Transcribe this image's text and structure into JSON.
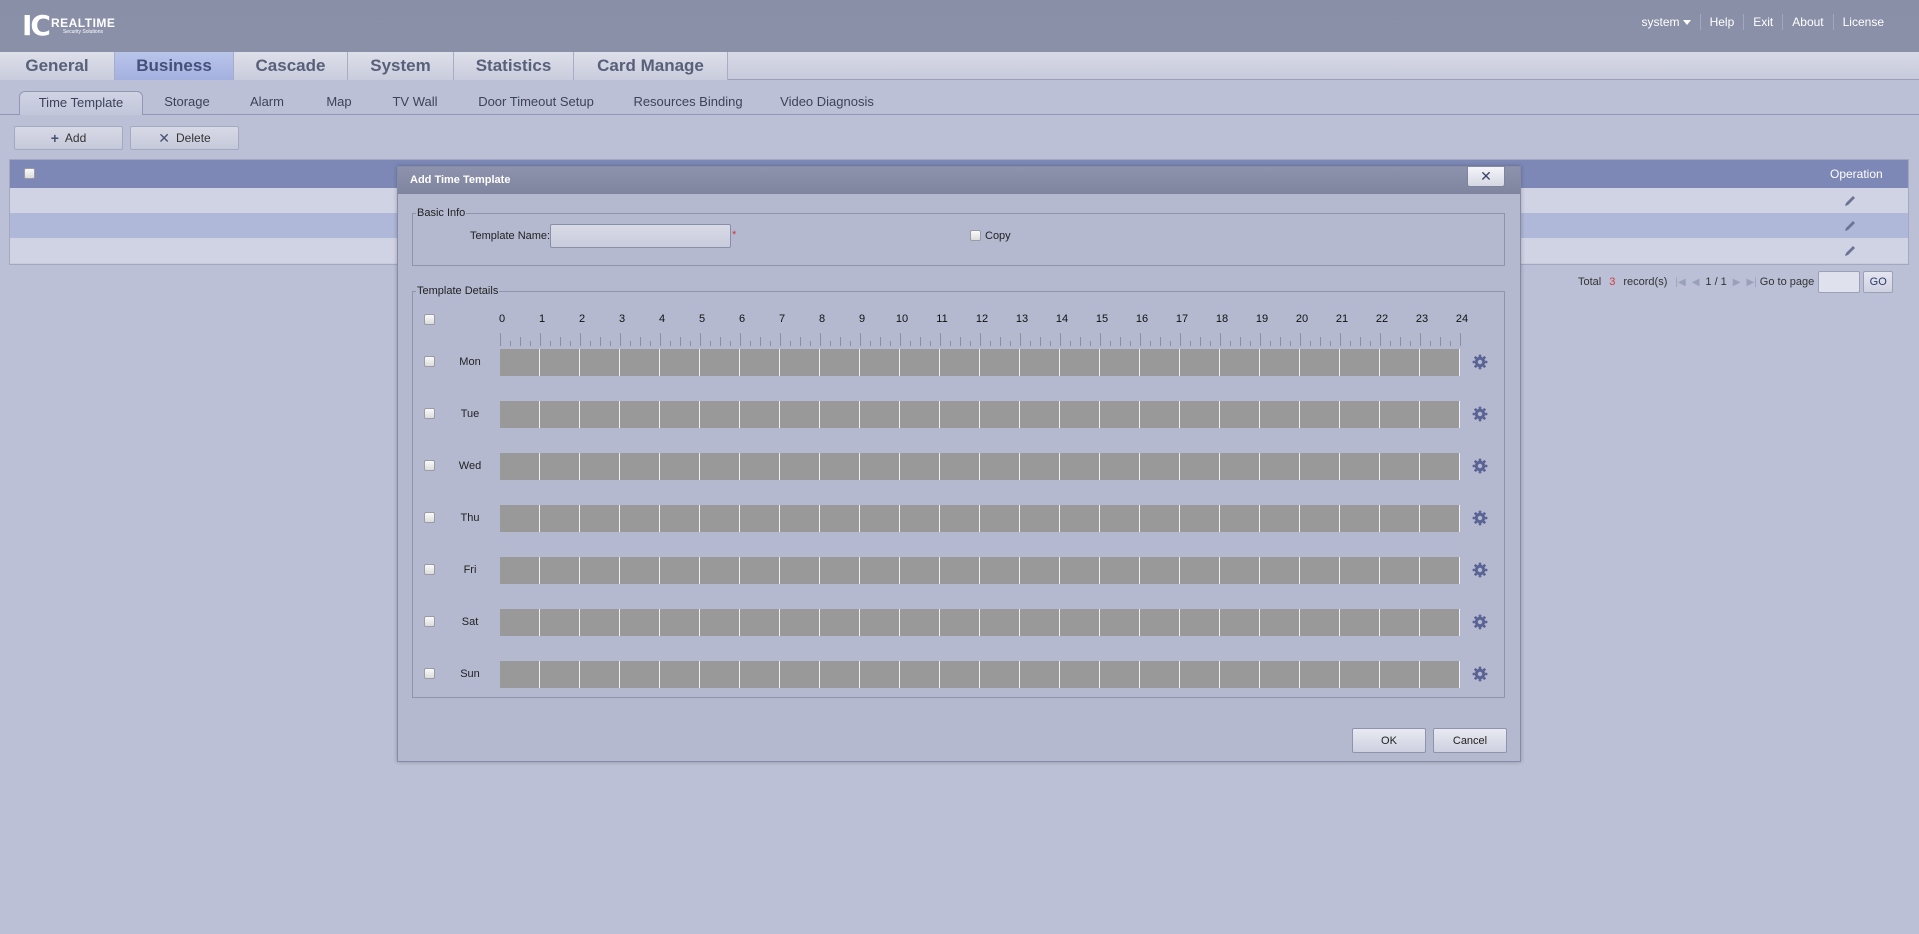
{
  "header": {
    "logo_mark": "IC",
    "logo_brand": "REALTIME",
    "logo_tagline": "Security Solutions",
    "user": "system",
    "links": [
      "Help",
      "Exit",
      "About",
      "License"
    ]
  },
  "main_tabs": [
    "General",
    "Business",
    "Cascade",
    "System",
    "Statistics",
    "Card Manage"
  ],
  "active_main_tab": "Business",
  "sub_tabs": [
    "Time Template",
    "Storage",
    "Alarm",
    "Map",
    "TV Wall",
    "Door Timeout Setup",
    "Resources Binding",
    "Video Diagnosis"
  ],
  "active_sub_tab": "Time Template",
  "toolbar": {
    "add_label": "Add",
    "delete_label": "Delete"
  },
  "table": {
    "operation_header": "Operation",
    "row_count": 3
  },
  "pager": {
    "total_label": "Total",
    "total_records": "3",
    "records_label": "record(s)",
    "page_status": "1 / 1",
    "goto_label": "Go to page",
    "go_label": "GO"
  },
  "dialog": {
    "title": "Add Time Template",
    "close_glyph": "✕",
    "basic_info_legend": "Basic Info",
    "template_name_label": "Template Name:",
    "template_name_value": "",
    "required_mark": "*",
    "copy_label": "Copy",
    "template_details_legend": "Template Details",
    "hours": [
      "0",
      "1",
      "2",
      "3",
      "4",
      "5",
      "6",
      "7",
      "8",
      "9",
      "10",
      "11",
      "12",
      "13",
      "14",
      "15",
      "16",
      "17",
      "18",
      "19",
      "20",
      "21",
      "22",
      "23",
      "24"
    ],
    "days": [
      "Mon",
      "Tue",
      "Wed",
      "Thu",
      "Fri",
      "Sat",
      "Sun"
    ],
    "ok_label": "OK",
    "cancel_label": "Cancel"
  },
  "colors": {
    "accent": "#7d88b6",
    "bar_fill": "#999999",
    "required": "#d23a3a"
  }
}
